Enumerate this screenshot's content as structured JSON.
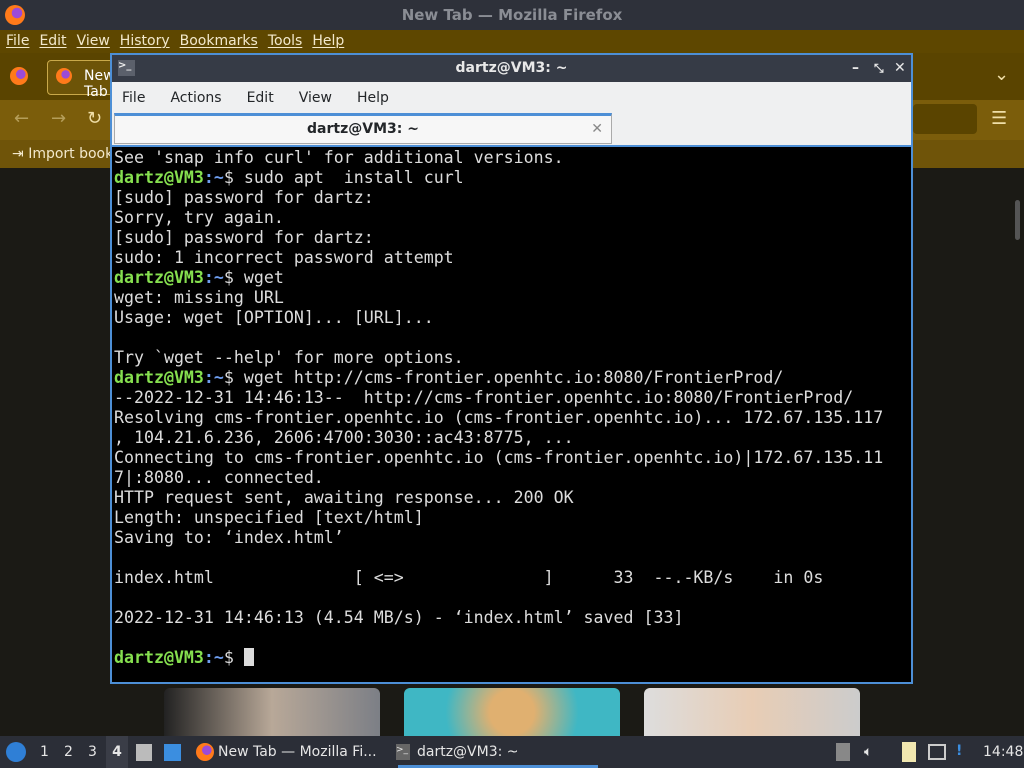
{
  "firefox": {
    "title": "New Tab — Mozilla Firefox",
    "menu": [
      "File",
      "Edit",
      "View",
      "History",
      "Bookmarks",
      "Tools",
      "Help"
    ],
    "tab_label": "New Tab",
    "bookmark_label": "Import bookmarks..."
  },
  "terminal": {
    "title": "dartz@VM3: ~",
    "menu": [
      "File",
      "Actions",
      "Edit",
      "View",
      "Help"
    ],
    "tab_label": "dartz@VM3: ~",
    "prompt_user": "dartz@VM3",
    "prompt_path": ":~",
    "prompt_sign": "$ ",
    "lines": [
      {
        "t": "See 'snap info curl' for additional versions."
      },
      {
        "cmd": "sudo apt  install curl"
      },
      {
        "t": "[sudo] password for dartz: "
      },
      {
        "t": "Sorry, try again."
      },
      {
        "t": "[sudo] password for dartz: "
      },
      {
        "t": "sudo: 1 incorrect password attempt"
      },
      {
        "cmd": "wget"
      },
      {
        "t": "wget: missing URL"
      },
      {
        "t": "Usage: wget [OPTION]... [URL]..."
      },
      {
        "t": ""
      },
      {
        "t": "Try `wget --help' for more options."
      },
      {
        "cmd": "wget http://cms-frontier.openhtc.io:8080/FrontierProd/"
      },
      {
        "t": "--2022-12-31 14:46:13--  http://cms-frontier.openhtc.io:8080/FrontierProd/"
      },
      {
        "t": "Resolving cms-frontier.openhtc.io (cms-frontier.openhtc.io)... 172.67.135.117"
      },
      {
        "t": ", 104.21.6.236, 2606:4700:3030::ac43:8775, ..."
      },
      {
        "t": "Connecting to cms-frontier.openhtc.io (cms-frontier.openhtc.io)|172.67.135.11"
      },
      {
        "t": "7|:8080... connected."
      },
      {
        "t": "HTTP request sent, awaiting response... 200 OK"
      },
      {
        "t": "Length: unspecified [text/html]"
      },
      {
        "t": "Saving to: ‘index.html’"
      },
      {
        "t": ""
      },
      {
        "t": "index.html              [ <=>              ]      33  --.-KB/s    in 0s"
      },
      {
        "t": ""
      },
      {
        "t": "2022-12-31 14:46:13 (4.54 MB/s) - ‘index.html’ saved [33]"
      },
      {
        "t": ""
      },
      {
        "cmd": "",
        "cursor": true
      }
    ]
  },
  "taskbar": {
    "workspaces": [
      "1",
      "2",
      "3",
      "4"
    ],
    "active_workspace": "4",
    "tasks": [
      {
        "label": "New Tab — Mozilla Fi...",
        "icon": "firefox-icon"
      },
      {
        "label": "dartz@VM3: ~",
        "icon": "terminal-icon",
        "active": true
      }
    ],
    "clock": "14:48"
  },
  "colors": {
    "accent": "#4d8fd6",
    "prompt_user": "#86e04f",
    "prompt_path": "#6e9ef0"
  }
}
